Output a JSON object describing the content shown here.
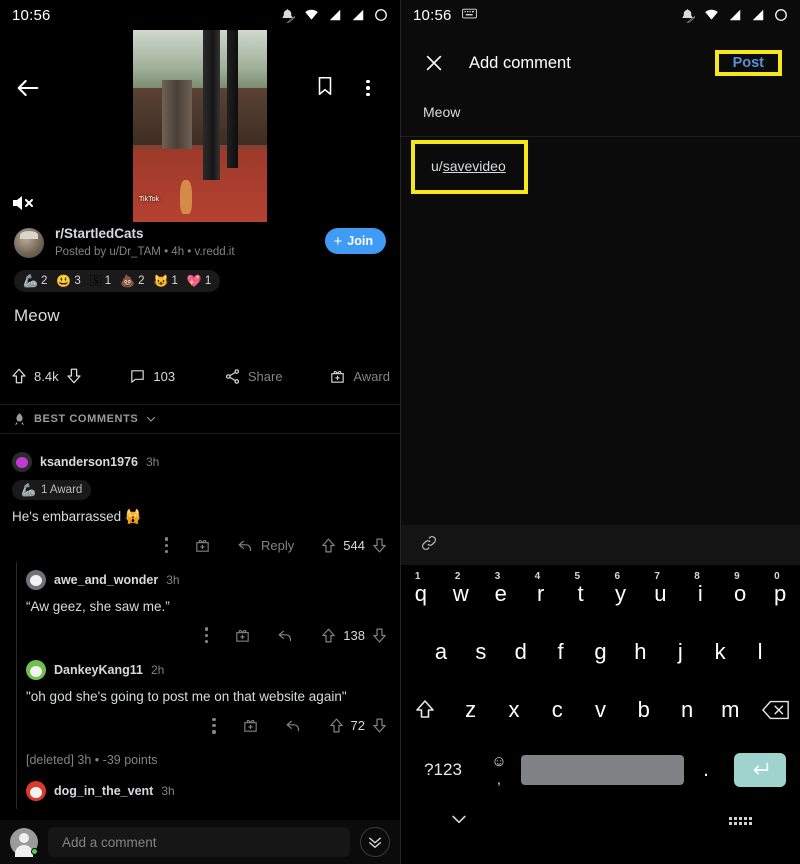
{
  "left": {
    "status": {
      "time": "10:56",
      "icons": [
        "bell-off-icon",
        "wifi-icon",
        "signal-icon",
        "signal-x-icon",
        "circle-icon"
      ]
    },
    "toolbar": {
      "back": "back-arrow",
      "save": "bookmark",
      "more": "overflow-menu",
      "mute": "volume-muted",
      "video_watermark": "TikTok"
    },
    "post": {
      "subreddit": "r/StartledCats",
      "byline": "Posted by u/Dr_TAM • 4h • v.redd.it",
      "join_label": "Join",
      "join_plus": "+",
      "title": "Meow",
      "awards": [
        {
          "icon": "🦾",
          "count": "2"
        },
        {
          "icon": "😃",
          "count": "3"
        },
        {
          "icon": "🅂",
          "count": "1"
        },
        {
          "icon": "💩",
          "count": "2"
        },
        {
          "icon": "😺",
          "count": "1"
        },
        {
          "icon": "💖",
          "count": "1"
        }
      ],
      "upvotes": "8.4k",
      "comments_count": "103",
      "share_label": "Share",
      "award_label": "Award"
    },
    "sort": {
      "label": "BEST COMMENTS"
    },
    "comments": [
      {
        "user": "ksanderson1976",
        "time": "3h",
        "avatar": "purple",
        "award_badge": "1 Award",
        "award_icon": "🦾",
        "body": "He's embarrassed 🙀",
        "reply_label": "Reply",
        "votes": "544",
        "level": 0
      },
      {
        "user": "awe_and_wonder",
        "time": "3h",
        "avatar": "grey",
        "body": "“Aw geez, she saw me.”",
        "votes": "138",
        "level": 0
      },
      {
        "user": "DankeyKang11",
        "time": "2h",
        "avatar": "green",
        "body": "\"oh god she's going to post me on that website again\"",
        "votes": "72",
        "level": 1
      }
    ],
    "deleted_comment": "[deleted] 3h • -39 points",
    "last_comment": {
      "user": "dog_in_the_vent",
      "time": "3h",
      "avatar": "red"
    },
    "compose": {
      "placeholder": "Add a comment",
      "collapse": "chevron-double-down"
    }
  },
  "right": {
    "status": {
      "time": "10:56",
      "keyboard_icon": "keyboard-icon"
    },
    "header": {
      "close": "close-icon",
      "title": "Add comment",
      "post": "Post"
    },
    "post_label": "Meow",
    "editor": {
      "prefix": "u/",
      "link": "savevideo"
    },
    "toolbar": {
      "link_icon": "link-icon"
    },
    "keyboard": {
      "row1": [
        {
          "k": "q",
          "n": "1"
        },
        {
          "k": "w",
          "n": "2"
        },
        {
          "k": "e",
          "n": "3"
        },
        {
          "k": "r",
          "n": "4"
        },
        {
          "k": "t",
          "n": "5"
        },
        {
          "k": "y",
          "n": "6"
        },
        {
          "k": "u",
          "n": "7"
        },
        {
          "k": "i",
          "n": "8"
        },
        {
          "k": "o",
          "n": "9"
        },
        {
          "k": "p",
          "n": "0"
        }
      ],
      "row2": [
        "a",
        "s",
        "d",
        "f",
        "g",
        "h",
        "j",
        "k",
        "l"
      ],
      "row3": [
        "z",
        "x",
        "c",
        "v",
        "b",
        "n",
        "m"
      ],
      "shift": "shift-icon",
      "backspace": "backspace-icon",
      "sym_label": "?123",
      "emoji": "☺",
      "comma": ",",
      "period": ".",
      "enter": "enter-icon",
      "nav_down": "chevron-down-icon",
      "nav_keyboard": "keyboard-switch-icon"
    }
  },
  "colors": {
    "accent_blue": "#3f9bf4",
    "post_blue": "#5a8fd6",
    "highlight_yellow": "#f5e71c",
    "enter_teal": "#9fd4ce",
    "text_primary": "#d7dadc",
    "text_secondary": "#818384"
  }
}
